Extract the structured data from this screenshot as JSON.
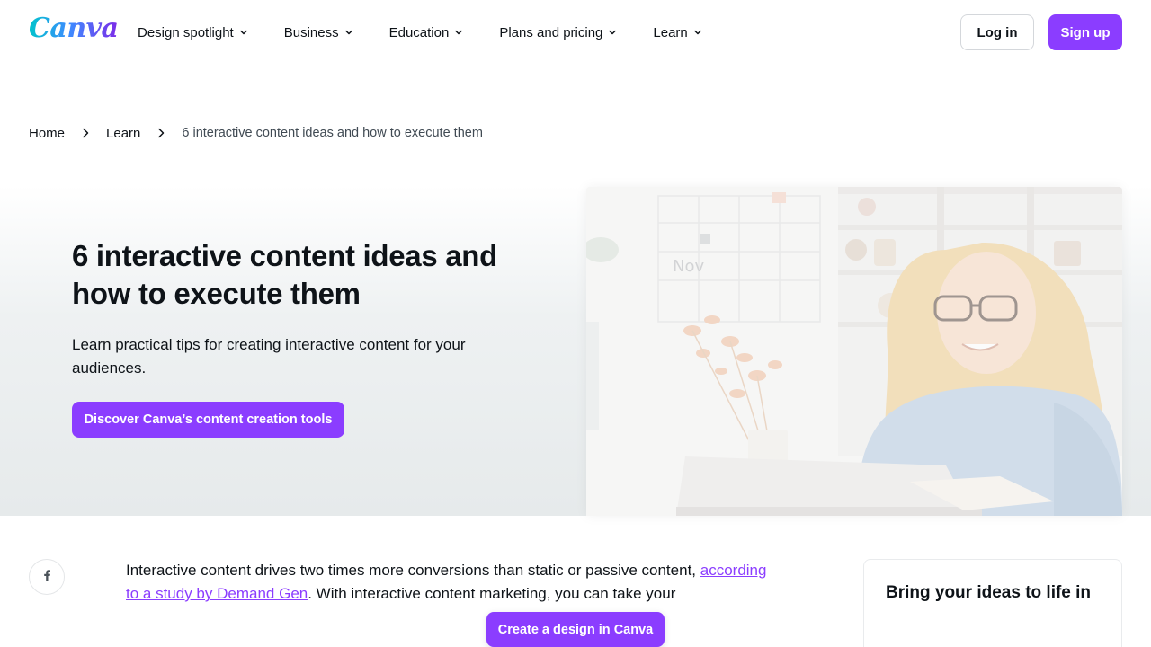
{
  "brand": {
    "logo_text": "Canva",
    "accent": "#8b3dff"
  },
  "nav": {
    "items": [
      {
        "label": "Design spotlight",
        "icon": "chevron-down-icon"
      },
      {
        "label": "Business",
        "icon": "chevron-down-icon"
      },
      {
        "label": "Education",
        "icon": "chevron-down-icon"
      },
      {
        "label": "Plans and pricing",
        "icon": "chevron-down-icon"
      },
      {
        "label": "Learn",
        "icon": "chevron-down-icon"
      }
    ],
    "login_label": "Log in",
    "signup_label": "Sign up"
  },
  "breadcrumb": {
    "items": [
      "Home",
      "Learn"
    ],
    "current": "6 interactive content ideas and how to execute them"
  },
  "hero": {
    "title": "6 interactive content ideas and how to execute them",
    "subtitle": "Learn practical tips for creating interactive content for your audiences.",
    "cta_label": "Discover Canva’s content creation tools",
    "image_desc_icon": "photo-woman-laptop",
    "image_text": "Nov"
  },
  "article": {
    "text_before_link": "Interactive content drives two times more conversions than static or passive content, ",
    "link_text": "according to a study by Demand Gen",
    "text_after_link": ". With interactive content marketing, you can take your"
  },
  "share": {
    "icon": "facebook-icon"
  },
  "sidecard": {
    "title": "Bring your ideas to life in"
  },
  "floating_cta": {
    "label": "Create a design in Canva"
  }
}
